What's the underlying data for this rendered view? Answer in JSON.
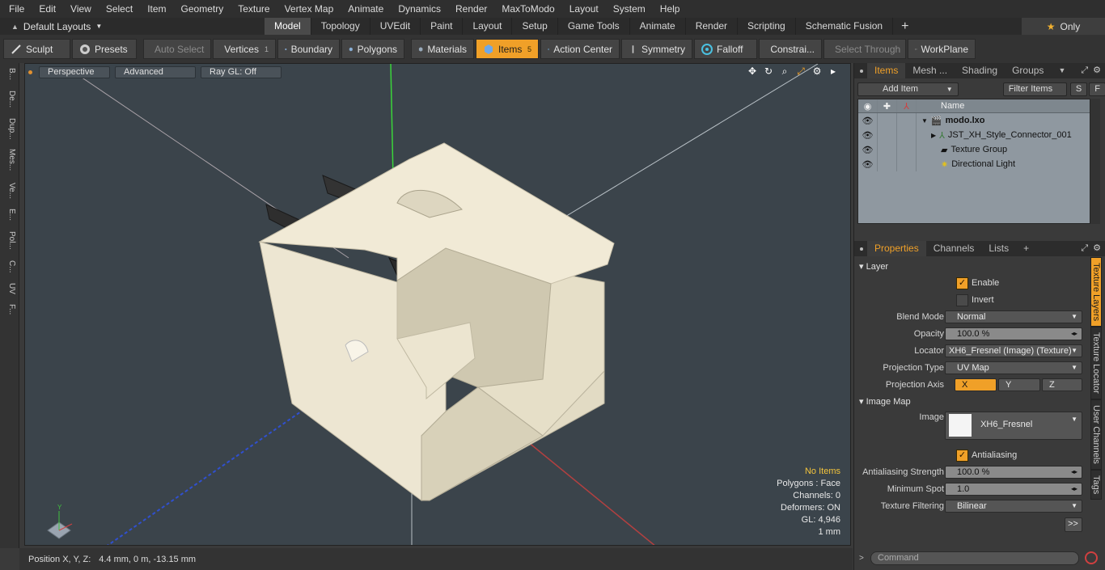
{
  "menu": [
    "File",
    "Edit",
    "View",
    "Select",
    "Item",
    "Geometry",
    "Texture",
    "Vertex Map",
    "Animate",
    "Dynamics",
    "Render",
    "MaxToModo",
    "Layout",
    "System",
    "Help"
  ],
  "layout_selector": "Default Layouts",
  "layout_tabs": [
    "Model",
    "Topology",
    "UVEdit",
    "Paint",
    "Layout",
    "Setup",
    "Game Tools",
    "Animate",
    "Render",
    "Scripting",
    "Schematic Fusion"
  ],
  "active_layout_tab": "Model",
  "only_label": "Only",
  "toolbar": {
    "sculpt": "Sculpt",
    "presets": "Presets",
    "auto_select": "Auto Select",
    "vertices": "Vertices",
    "vertices_count": "1",
    "boundary": "Boundary",
    "polygons": "Polygons",
    "materials": "Materials",
    "items": "Items",
    "items_count": "5",
    "action_center": "Action Center",
    "symmetry": "Symmetry",
    "falloff": "Falloff",
    "constrain": "Constrai...",
    "select_through": "Select Through",
    "workplane": "WorkPlane"
  },
  "left_strip": [
    "B...",
    "De...",
    "Dup...",
    "Mes...",
    "Ve...",
    "E...",
    "Pol...",
    "C...",
    "UV",
    "F..."
  ],
  "viewport": {
    "view_mode": "Perspective",
    "advanced": "Advanced",
    "raygl": "Ray GL: Off",
    "info": {
      "selection": "No Items",
      "polygons": "Polygons : Face",
      "channels": "Channels: 0",
      "deformers": "Deformers: ON",
      "gl": "GL: 4,946",
      "unit": "1 mm"
    }
  },
  "status": {
    "label": "Position X, Y, Z:",
    "value": "4.4 mm, 0 m, -13.15 mm"
  },
  "items_panel": {
    "tabs": [
      "Items",
      "Mesh ...",
      "Shading",
      "Groups"
    ],
    "add_item": "Add Item",
    "filter_items": "Filter Items",
    "btn_s": "S",
    "btn_f": "F",
    "col_name": "Name",
    "rows": [
      {
        "name": "modo.lxo",
        "bold": true,
        "indent": 0
      },
      {
        "name": "JST_XH_Style_Connector_001",
        "bold": false,
        "indent": 1
      },
      {
        "name": "Texture Group",
        "bold": false,
        "indent": 1
      },
      {
        "name": "Directional Light",
        "bold": false,
        "indent": 1
      }
    ]
  },
  "properties_panel": {
    "tabs": [
      "Properties",
      "Channels",
      "Lists"
    ],
    "layer_section": "Layer",
    "enable": "Enable",
    "invert": "Invert",
    "blend_mode_label": "Blend Mode",
    "blend_mode": "Normal",
    "opacity_label": "Opacity",
    "opacity": "100.0 %",
    "locator_label": "Locator",
    "locator": "XH6_Fresnel (Image) (Texture)",
    "projection_type_label": "Projection Type",
    "projection_type": "UV Map",
    "projection_axis_label": "Projection Axis",
    "axis_x": "X",
    "axis_y": "Y",
    "axis_z": "Z",
    "image_map_section": "Image Map",
    "image_label": "Image",
    "image": "XH6_Fresnel",
    "antialiasing": "Antialiasing",
    "aa_strength_label": "Antialiasing Strength",
    "aa_strength": "100.0 %",
    "min_spot_label": "Minimum Spot",
    "min_spot": "1.0",
    "tex_filter_label": "Texture Filtering",
    "tex_filter": "Bilinear",
    "more": ">>"
  },
  "side_tabs": [
    "Texture Layers",
    "Texture Locator",
    "User Channels",
    "Tags"
  ],
  "command_placeholder": "Command",
  "colors": {
    "accent": "#f0a028",
    "viewport_bg": "#3b444b",
    "model": "#ede6d2"
  }
}
